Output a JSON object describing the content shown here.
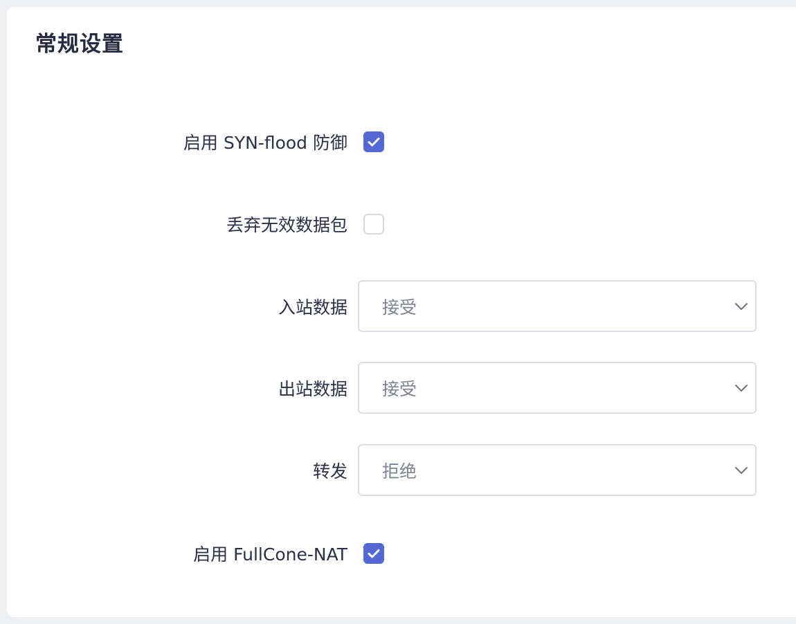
{
  "section": {
    "title": "常规设置"
  },
  "settings": {
    "syn_flood": {
      "label": "启用 SYN-flood 防御",
      "checked": true
    },
    "drop_invalid": {
      "label": "丢弃无效数据包",
      "checked": false
    },
    "input": {
      "label": "入站数据",
      "value": "接受"
    },
    "output": {
      "label": "出站数据",
      "value": "接受"
    },
    "forward": {
      "label": "转发",
      "value": "拒绝"
    },
    "fullcone_nat": {
      "label": "启用 FullCone-NAT",
      "checked": true
    }
  },
  "icons": {
    "checkmark": "checkmark-icon",
    "dropdown": "chevron-down-icon"
  },
  "colors": {
    "accent": "#5468d4",
    "background": "#eef0f4",
    "card": "#ffffff",
    "label_text": "#2b3048",
    "select_text": "#7c8494",
    "border": "#dcdfe6"
  }
}
